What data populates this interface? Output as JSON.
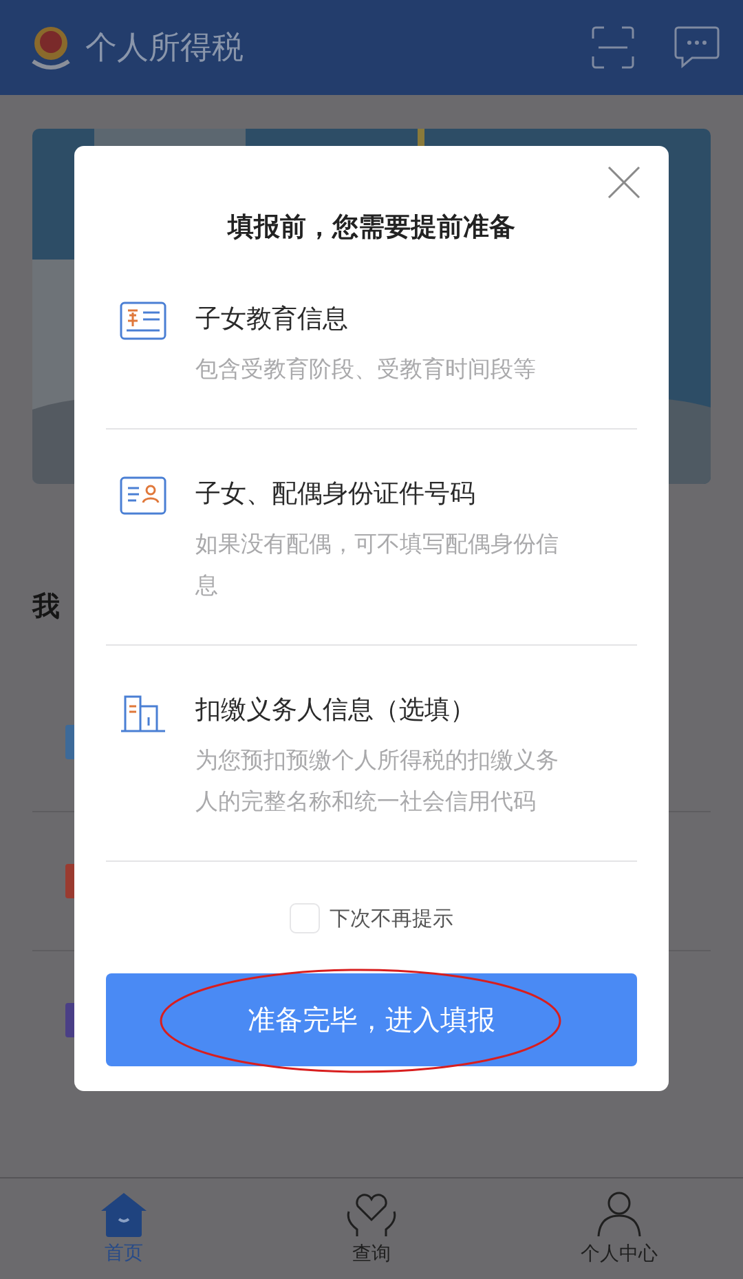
{
  "header": {
    "title": "个人所得税"
  },
  "section": {
    "heading": "我"
  },
  "services": [
    {
      "color": "#3d6a99"
    },
    {
      "color": "#9a3b30"
    },
    {
      "color": "#4a3f86"
    }
  ],
  "dialog": {
    "title": "填报前，您需要提前准备",
    "items": [
      {
        "kind": "education",
        "title": "子女教育信息",
        "description": "包含受教育阶段、受教育时间段等"
      },
      {
        "kind": "identity",
        "title": "子女、配偶身份证件号码",
        "description": "如果没有配偶，可不填写配偶身份信息"
      },
      {
        "kind": "employer",
        "title": "扣缴义务人信息（选填）",
        "description": "为您预扣预缴个人所得税的扣缴义务人的完整名称和统一社会信用代码"
      }
    ],
    "dont_show_again": {
      "label": "下次不再提示",
      "checked": false
    },
    "confirm_button": "准备完毕，进入填报"
  },
  "tab_bar": [
    {
      "kind": "home",
      "label": "首页",
      "selected": true
    },
    {
      "kind": "query",
      "label": "查询",
      "selected": false
    },
    {
      "kind": "profile",
      "label": "个人中心",
      "selected": false
    }
  ]
}
